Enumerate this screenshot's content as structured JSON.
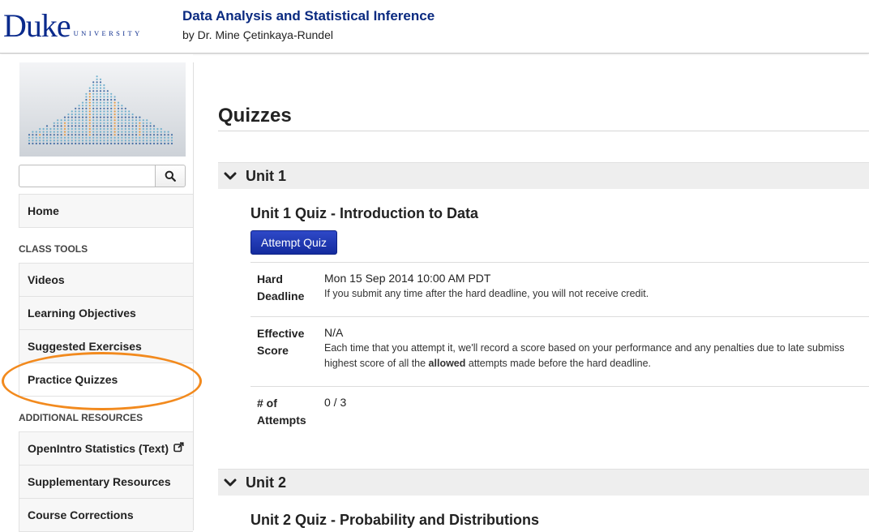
{
  "header": {
    "logo_main": "Duke",
    "logo_sub": "UNIVERSITY",
    "course_title": "Data Analysis and Statistical Inference",
    "instructor": "by Dr. Mine Çetinkaya-Rundel"
  },
  "sidebar": {
    "search": {
      "placeholder": "",
      "value": ""
    },
    "home_label": "Home",
    "class_tools_heading": "CLASS TOOLS",
    "class_tools": [
      {
        "label": "Videos"
      },
      {
        "label": "Learning Objectives"
      },
      {
        "label": "Suggested Exercises"
      },
      {
        "label": "Practice Quizzes"
      }
    ],
    "additional_heading": "ADDITIONAL RESOURCES",
    "additional": [
      {
        "label": "OpenIntro Statistics (Text)",
        "icon": "external-link-icon"
      },
      {
        "label": "Supplementary Resources"
      },
      {
        "label": "Course Corrections"
      }
    ],
    "active_item": "Practice Quizzes"
  },
  "main": {
    "page_title": "Quizzes",
    "units": [
      {
        "label": "Unit 1",
        "expanded": true,
        "quiz_title": "Unit 1 Quiz - Introduction to Data",
        "button_label": "Attempt Quiz",
        "details": {
          "hard_deadline_label": "Hard Deadline",
          "hard_deadline_value": "Mon 15 Sep 2014 10:00 AM PDT",
          "hard_deadline_note": "If you submit any time after the hard deadline, you will not receive credit.",
          "effective_score_label": "Effective Score",
          "effective_score_value": "N/A",
          "effective_score_note_1": "Each time that you attempt it, we'll record a score based on your performance and any penalties due to late submiss",
          "effective_score_note_2_pre": "highest score of all the ",
          "effective_score_note_2_bold": "allowed",
          "effective_score_note_2_post": " attempts made before the hard deadline.",
          "attempts_label": "# of Attempts",
          "attempts_value": "0 / 3"
        }
      },
      {
        "label": "Unit 2",
        "expanded": true,
        "quiz_title": "Unit 2 Quiz - Probability and Distributions"
      }
    ]
  },
  "colors": {
    "brand_blue": "#0a2a8c",
    "button_blue": "#1f3bb8",
    "highlight_orange": "#f28a1e"
  }
}
